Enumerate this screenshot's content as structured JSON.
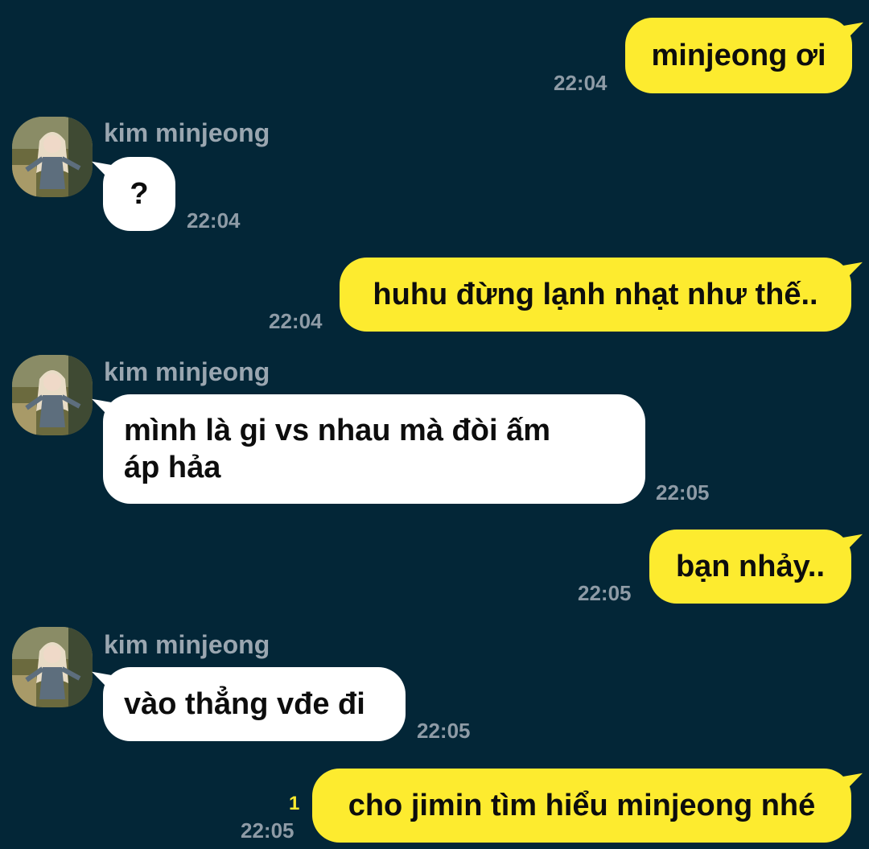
{
  "contact": {
    "name": "kim minjeong"
  },
  "messages": [
    {
      "from": "me",
      "text": "minjeong ơi",
      "time": "22:04"
    },
    {
      "from": "them",
      "sender": "kim minjeong",
      "text": "?",
      "time": "22:04"
    },
    {
      "from": "me",
      "text": "huhu đừng lạnh nhạt như thế..",
      "time": "22:04"
    },
    {
      "from": "them",
      "sender": "kim minjeong",
      "lines": [
        "mình là gi vs nhau mà đòi ấm",
        "áp hảa"
      ],
      "time": "22:05"
    },
    {
      "from": "me",
      "text": "bạn nhảy..",
      "time": "22:05"
    },
    {
      "from": "them",
      "sender": "kim minjeong",
      "text": "vào thẳng vđe đi",
      "time": "22:05"
    },
    {
      "from": "me",
      "text": "cho jimin tìm hiểu minjeong nhé",
      "time": "22:05",
      "unread": "1"
    }
  ],
  "colors": {
    "background": "#032637",
    "my_bubble": "#fdeb2f",
    "their_bubble": "#ffffff",
    "timestamp": "#8e9ba6",
    "unread_count": "#fdeb2f"
  }
}
